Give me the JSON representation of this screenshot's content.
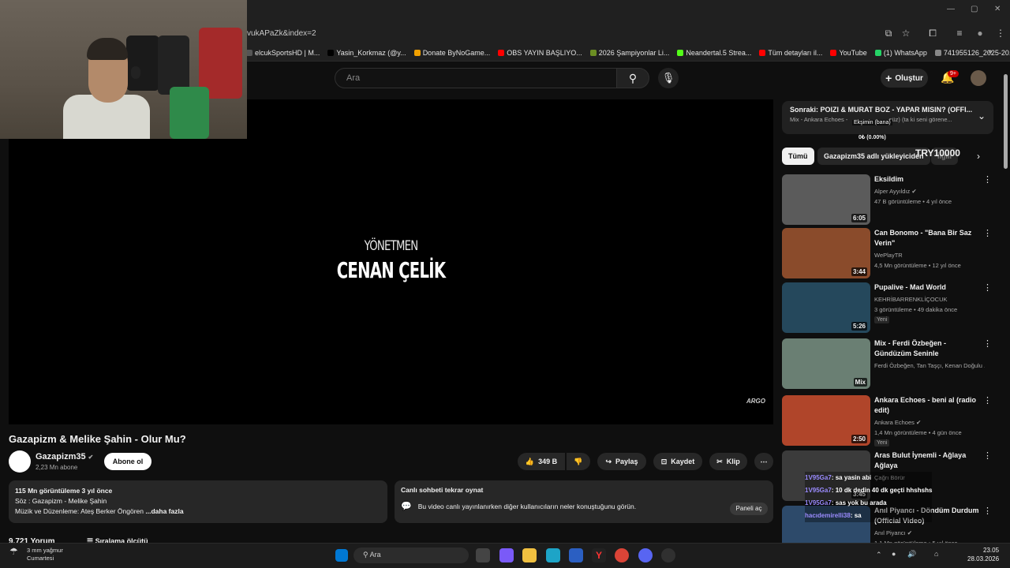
{
  "browser": {
    "url": "vukAPaZk&index=2",
    "bookmarks": [
      {
        "label": "elcukSportsHD | M...",
        "color": "#555555"
      },
      {
        "label": "Yasin_Korkmaz (@y...",
        "color": "#000000"
      },
      {
        "label": "Donate ByNoGame...",
        "color": "#f0a000"
      },
      {
        "label": "OBS YAYIN BAŞLIYO...",
        "color": "#ff0000"
      },
      {
        "label": "2026 Şampiyonlar Li...",
        "color": "#6b8e23"
      },
      {
        "label": "Neandertal.5 Strea...",
        "color": "#53fc18"
      },
      {
        "label": "Tüm detayları il...",
        "color": "#ff0000"
      },
      {
        "label": "YouTube",
        "color": "#ff0000"
      },
      {
        "label": "(1) WhatsApp",
        "color": "#25d366"
      },
      {
        "label": "741955126_2025-20...",
        "color": "#888888"
      }
    ]
  },
  "header": {
    "search_placeholder": "Ara",
    "create_label": "Oluştur",
    "notification_badge": "9+"
  },
  "player": {
    "credit_small": "YÖNETMEN",
    "credit_big": "CENAN ÇELİK",
    "watermark": "ARGO"
  },
  "video": {
    "title": "Gazapizm & Melike Şahin - Olur Mu?",
    "channel": "Gazapizm35",
    "subscribers": "2,23 Mn abone",
    "subscribe_label": "Abone ol",
    "likes": "349 B",
    "share_label": "Paylaş",
    "save_label": "Kaydet",
    "clip_label": "Klip",
    "desc_stats": "115 Mn görüntüleme  3 yıl önce",
    "desc_line1": "Söz : Gazapizm - Melike Şahin",
    "desc_line2": "Müzik ve Düzenleme: Ateş Berker Öngören",
    "desc_more": "...daha fazla",
    "chat_title": "Canlı sohbeti tekrar oynat",
    "chat_desc": "Bu video canlı yayınlanırken diğer kullanıcıların neler konuştuğunu görün.",
    "chat_open": "Paneli aç",
    "comments_count": "9.721 Yorum",
    "sort_label": "Sıralama ölçütü"
  },
  "sidebar": {
    "upnext_title": "Sonraki: POIZI & MURAT BOZ - YAPAR MISIN? (OFFI...",
    "upnext_sub": "Mix - Ankara Echoes - ",
    "upnext_sub_tail": "...süz) (ta ki seni görene...",
    "overlay_name": "Ekşimin (bana)",
    "overlay_progress": "0₺ (0.00%)",
    "overlay_goal": "TRY10000",
    "chips": [
      "Tümü",
      "Gazapizm35 adlı yükleyiciden",
      "İlgili"
    ],
    "videos": [
      {
        "title": "Eksildim",
        "channel": "Alper Ayyıldız",
        "verified": true,
        "meta": "47 B görüntüleme • 4 yıl önce",
        "duration": "6:05",
        "new": "",
        "color": "#5b5b5b"
      },
      {
        "title": "Can Bonomo - \"Bana Bir Saz Verin\"",
        "channel": "WePlayTR",
        "verified": false,
        "meta": "4,5 Mn görüntüleme • 12 yıl önce",
        "duration": "3:44",
        "new": "",
        "color": "#8a4b2b"
      },
      {
        "title": "Pupalive - Mad World",
        "channel": "KEHRİBARRENKLİÇOCUK",
        "verified": false,
        "meta": "3 görüntüleme • 49 dakika önce",
        "duration": "5:26",
        "new": "Yeni",
        "color": "#25485c"
      },
      {
        "title": "Mix - Ferdi Özbeğen - Gündüzüm Seninle",
        "channel": "Ferdi Özbeğen, Tan Taşçı, Kenan Doğulu ...",
        "verified": false,
        "meta": "",
        "duration": "Mix",
        "new": "",
        "color": "#6a7f73"
      },
      {
        "title": "Ankara Echoes - beni al (radio edit)",
        "channel": "Ankara Echoes",
        "verified": true,
        "meta": "1,4 Mn görüntüleme • 4 gün önce",
        "duration": "2:50",
        "new": "Yeni",
        "color": "#b0452a"
      },
      {
        "title": "Aras Bulut İynemli - Ağlaya Ağlaya",
        "channel": "Çağrı Börür",
        "verified": false,
        "meta": "",
        "duration": "3:45",
        "new": "",
        "color": "#3b3b3b"
      },
      {
        "title": "Anıl Piyancı - Döndüm Durdum (Official Video)",
        "channel": "Anıl Piyancı",
        "verified": true,
        "meta": "1,1 Mn görüntüleme • 5 yıl önce",
        "duration": "",
        "new": "",
        "color": "#2d4a6a"
      }
    ],
    "chat_overlay": [
      {
        "user": "1V95Ga7",
        "msg": ": sa yasin abi"
      },
      {
        "user": "1V95Ga7",
        "msg": ": 10 dk dedin 40 dk geçti hhshshs"
      },
      {
        "user": "1V95Ga7",
        "msg": ": sas yok bu arada"
      },
      {
        "user": "hacıdemirelli38",
        "msg": ": sa"
      }
    ]
  },
  "taskbar": {
    "weather_temp": "3 mm yağmur",
    "weather_day": "Cumartesi",
    "search": "Ara",
    "time": "23.05",
    "date": "28.03.2026"
  }
}
